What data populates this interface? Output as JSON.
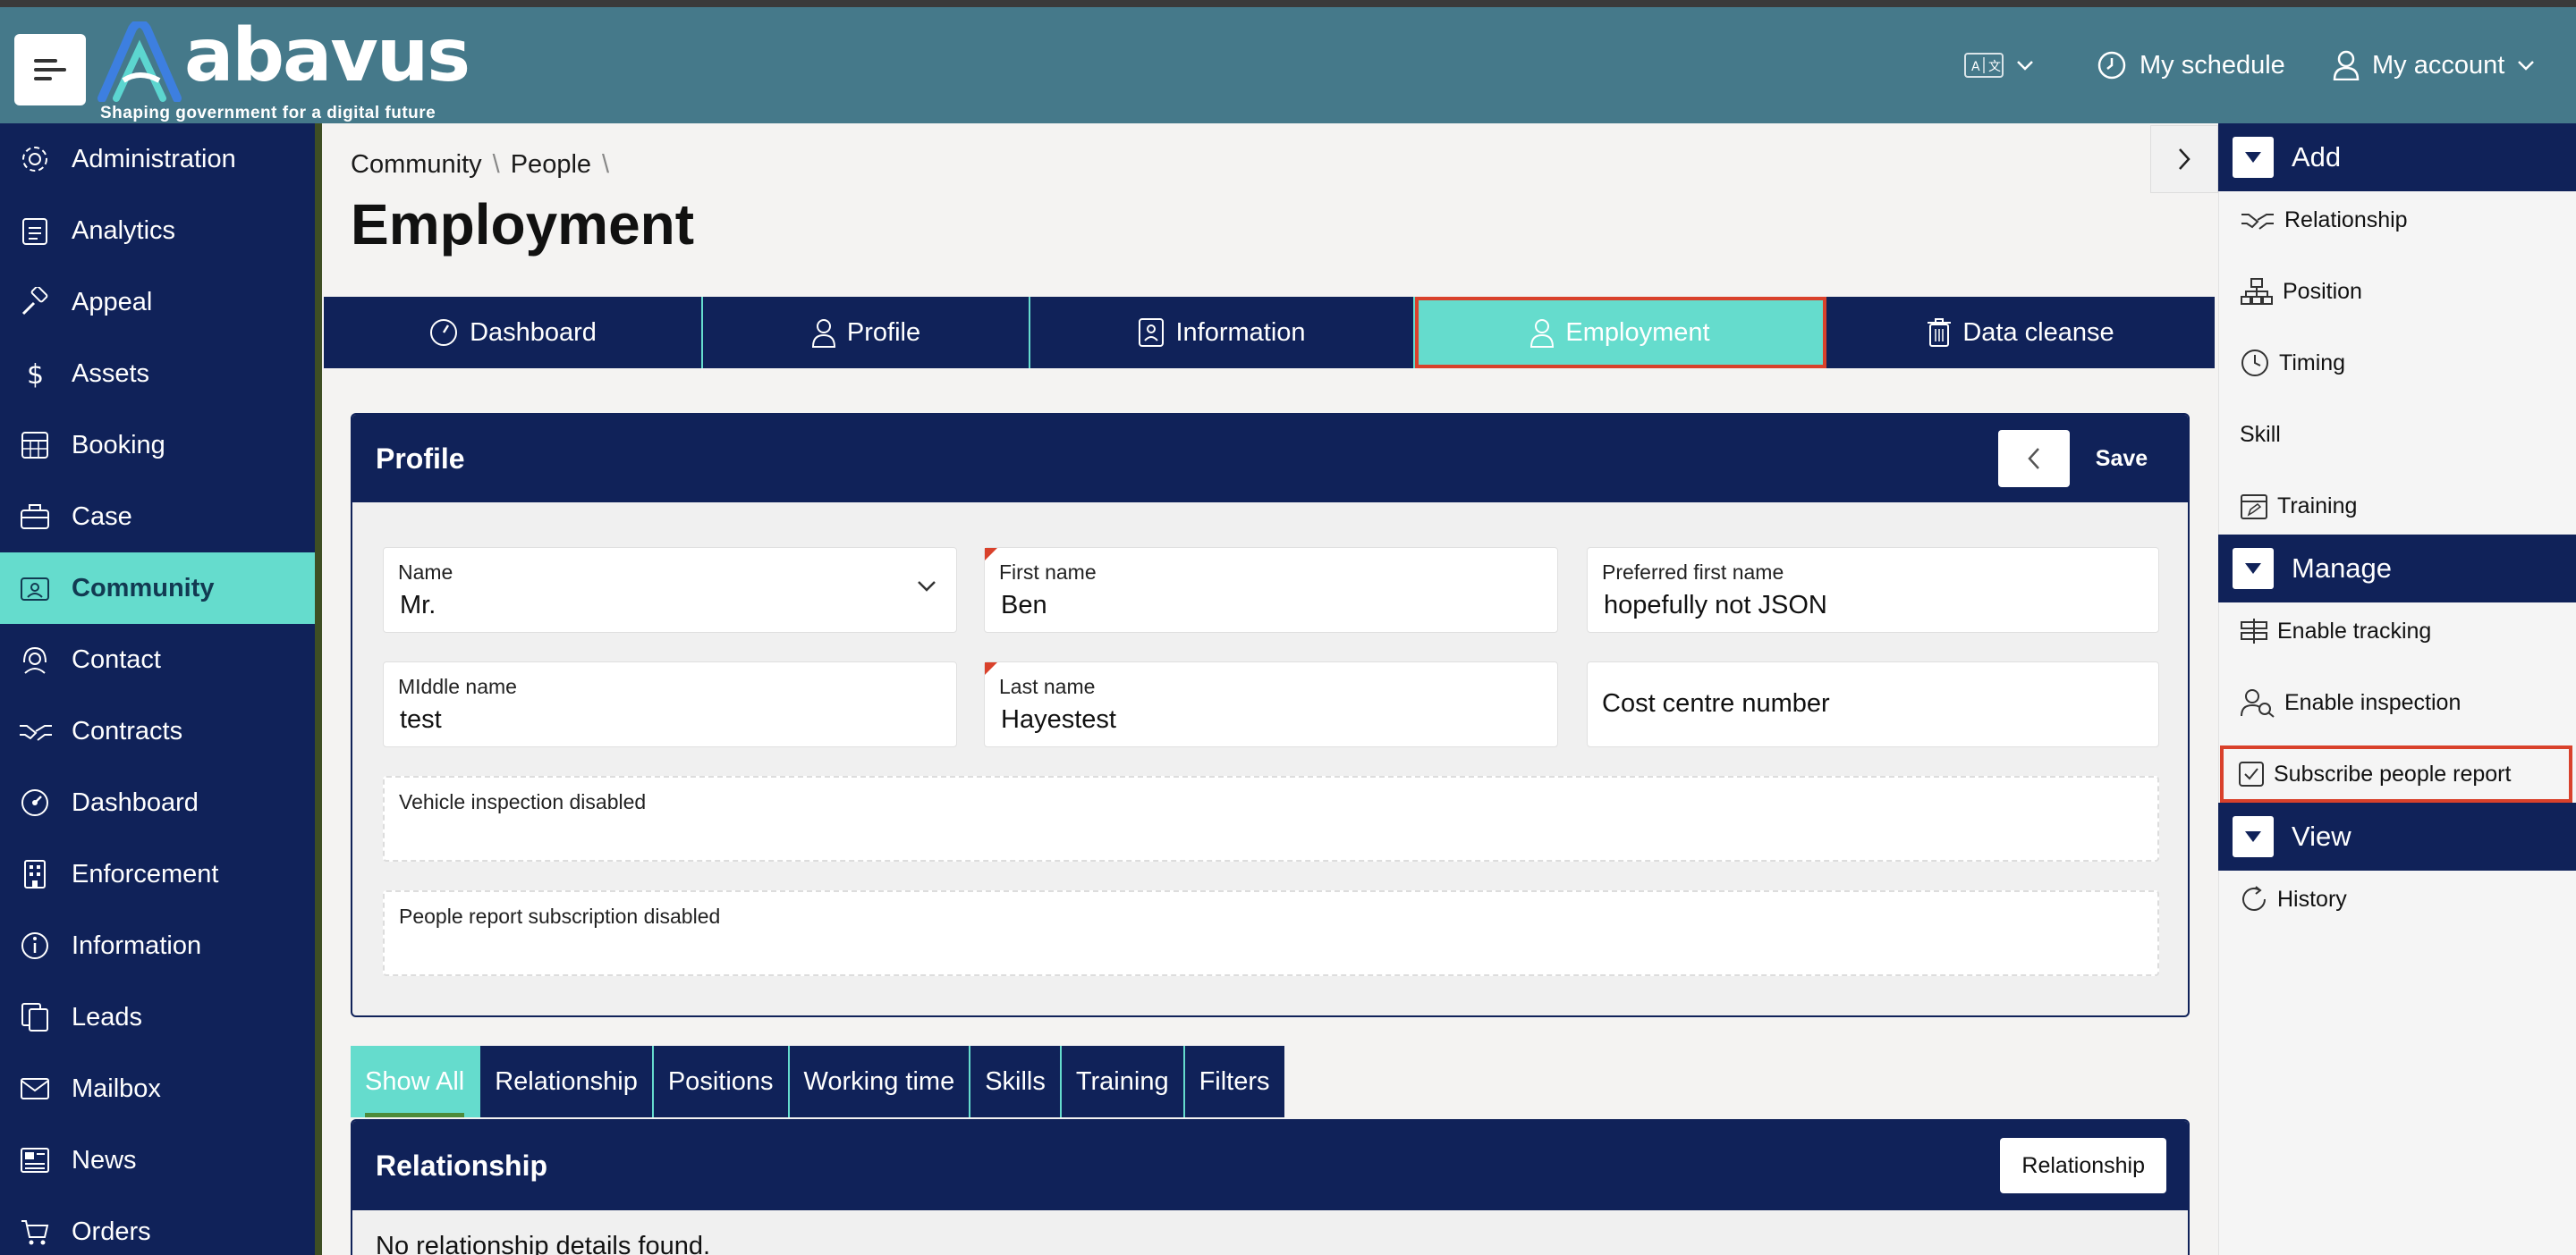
{
  "header": {
    "brand": "abavus",
    "tagline": "Shaping government for a digital future",
    "my_schedule": "My schedule",
    "my_account": "My account"
  },
  "sidebar": {
    "items": [
      {
        "label": "Administration",
        "icon": "gear-icon"
      },
      {
        "label": "Analytics",
        "icon": "clipboard-icon"
      },
      {
        "label": "Appeal",
        "icon": "gavel-icon"
      },
      {
        "label": "Assets",
        "icon": "dollar-icon"
      },
      {
        "label": "Booking",
        "icon": "calendar-grid-icon"
      },
      {
        "label": "Case",
        "icon": "briefcase-icon"
      },
      {
        "label": "Community",
        "icon": "id-card-icon",
        "active": true
      },
      {
        "label": "Contact",
        "icon": "headset-icon"
      },
      {
        "label": "Contracts",
        "icon": "handshake-icon"
      },
      {
        "label": "Dashboard",
        "icon": "gauge-icon"
      },
      {
        "label": "Enforcement",
        "icon": "building-icon"
      },
      {
        "label": "Information",
        "icon": "info-icon"
      },
      {
        "label": "Leads",
        "icon": "copy-icon"
      },
      {
        "label": "Mailbox",
        "icon": "envelope-icon"
      },
      {
        "label": "News",
        "icon": "newspaper-icon"
      },
      {
        "label": "Orders",
        "icon": "cart-icon"
      }
    ]
  },
  "breadcrumb": {
    "items": [
      "Community",
      "People"
    ]
  },
  "page": {
    "title": "Employment"
  },
  "tabs": [
    {
      "label": "Dashboard",
      "icon": "gauge-icon"
    },
    {
      "label": "Profile",
      "icon": "user-icon"
    },
    {
      "label": "Information",
      "icon": "contact-card-icon"
    },
    {
      "label": "Employment",
      "icon": "user-icon",
      "active": true
    },
    {
      "label": "Data cleanse",
      "icon": "trash-icon"
    }
  ],
  "profile_card": {
    "title": "Profile",
    "save_label": "Save",
    "fields": {
      "name": {
        "label": "Name",
        "value": "Mr."
      },
      "first_name": {
        "label": "First name",
        "value": "Ben"
      },
      "preferred_first_name": {
        "label": "Preferred first name",
        "value": "hopefully not JSON"
      },
      "middle_name": {
        "label": "MIddle name",
        "value": "test"
      },
      "last_name": {
        "label": "Last name",
        "value": "Hayestest"
      },
      "cost_centre": {
        "label": "Cost centre number"
      },
      "vehicle_inspection": {
        "label": "Vehicle inspection disabled"
      },
      "people_report": {
        "label": "People report subscription disabled"
      }
    }
  },
  "subtabs": [
    {
      "label": "Show All",
      "active": true
    },
    {
      "label": "Relationship"
    },
    {
      "label": "Positions"
    },
    {
      "label": "Working time"
    },
    {
      "label": "Skills"
    },
    {
      "label": "Training"
    },
    {
      "label": "Filters"
    }
  ],
  "relationship_card": {
    "title": "Relationship",
    "button": "Relationship",
    "empty": "No relationship details found."
  },
  "right_panel": {
    "add": {
      "title": "Add",
      "items": [
        "Relationship",
        "Position",
        "Timing",
        "Skill",
        "Training"
      ]
    },
    "manage": {
      "title": "Manage",
      "items": [
        "Enable tracking",
        "Enable inspection",
        "Subscribe people report"
      ]
    },
    "view": {
      "title": "View",
      "items": [
        "History"
      ]
    }
  },
  "colors": {
    "header": "#45798a",
    "navy": "#102259",
    "accent": "#65dccd",
    "highlight": "#d9412b"
  }
}
